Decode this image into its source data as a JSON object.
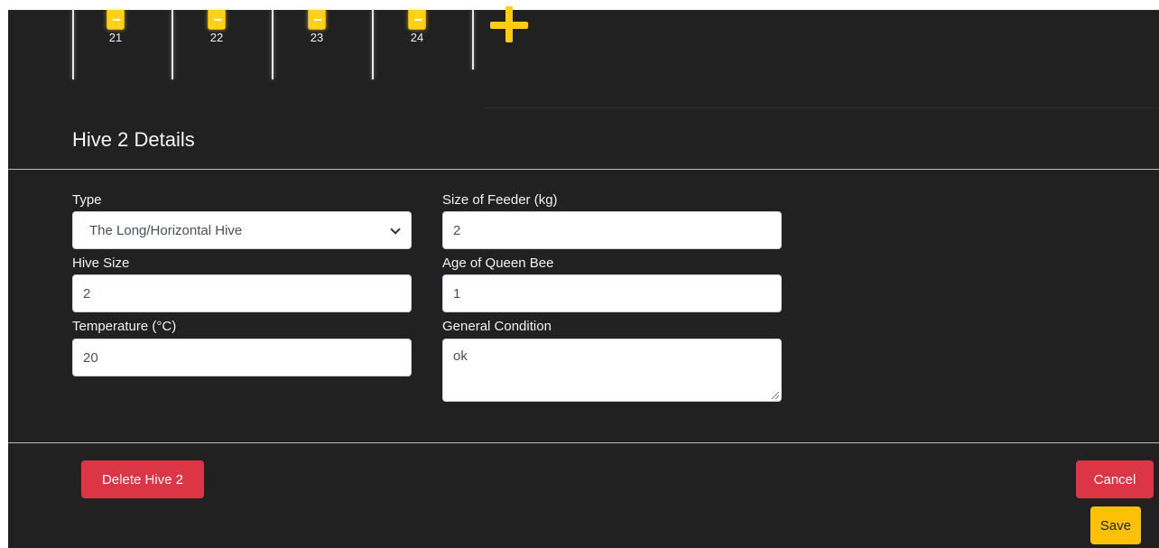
{
  "hives": [
    {
      "number": "21"
    },
    {
      "number": "22"
    },
    {
      "number": "23"
    },
    {
      "number": "24"
    }
  ],
  "details": {
    "title": "Hive 2 Details",
    "type": {
      "label": "Type",
      "value": "The Long/Horizontal Hive",
      "options": [
        "The Long/Horizontal Hive"
      ]
    },
    "feeder": {
      "label": "Size of Feeder (kg)",
      "value": "2"
    },
    "hive_size": {
      "label": "Hive Size",
      "value": "2"
    },
    "queen_age": {
      "label": "Age of Queen Bee",
      "value": "1"
    },
    "temperature": {
      "label": "Temperature (°C)",
      "value": "20"
    },
    "condition": {
      "label": "General Condition",
      "value": "ok"
    }
  },
  "actions": {
    "delete_label": "Delete Hive 2",
    "cancel_label": "Cancel",
    "save_label": "Save"
  },
  "colors": {
    "background": "#212121",
    "accent": "#ffcc0f",
    "danger": "#dc3545",
    "warning": "#ffc107"
  }
}
